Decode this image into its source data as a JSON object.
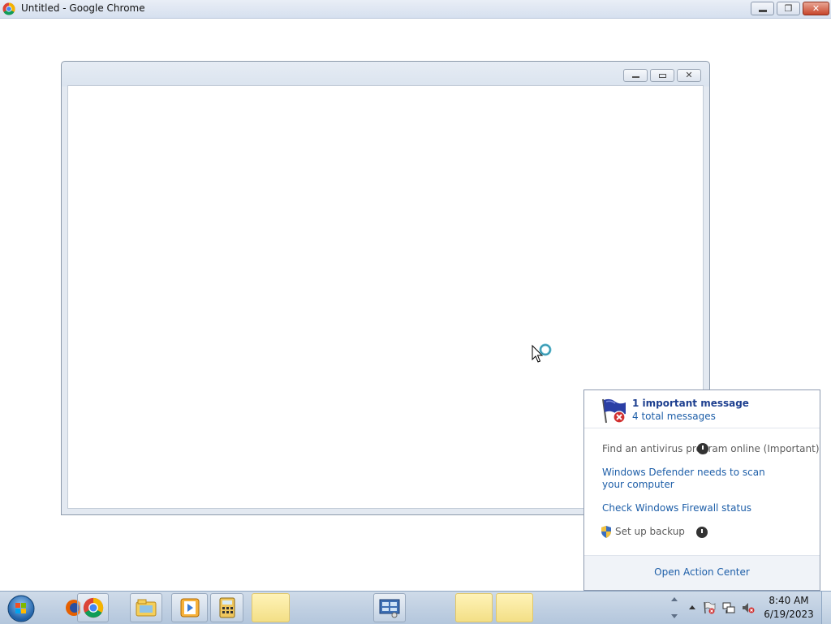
{
  "window": {
    "title": "Untitled - Google Chrome",
    "min_glyph": "",
    "max_glyph": "❐",
    "close_glyph": "✕"
  },
  "action_center": {
    "important": "1 important message",
    "total": "4 total messages",
    "items": [
      "Find an antivirus program online (Important)",
      "Windows Defender needs to scan your computer",
      "Check Windows Firewall status",
      "Set up backup"
    ],
    "open_link": "Open Action Center"
  },
  "taskbar": {
    "apps": [
      "firefox-icon",
      "chrome-icon",
      "file-explorer-icon",
      "media-player-icon",
      "calculator-icon",
      "remote-desktop-icon"
    ],
    "tray_icons": [
      "action-center-flag-icon",
      "network-icon",
      "volume-muted-icon"
    ]
  },
  "clock": {
    "time": "8:40 AM",
    "date": "6/19/2023"
  },
  "colors": {
    "link": "#1d5ea8",
    "taskbar": "#b3c6dc",
    "highlight": "#f3df86"
  }
}
